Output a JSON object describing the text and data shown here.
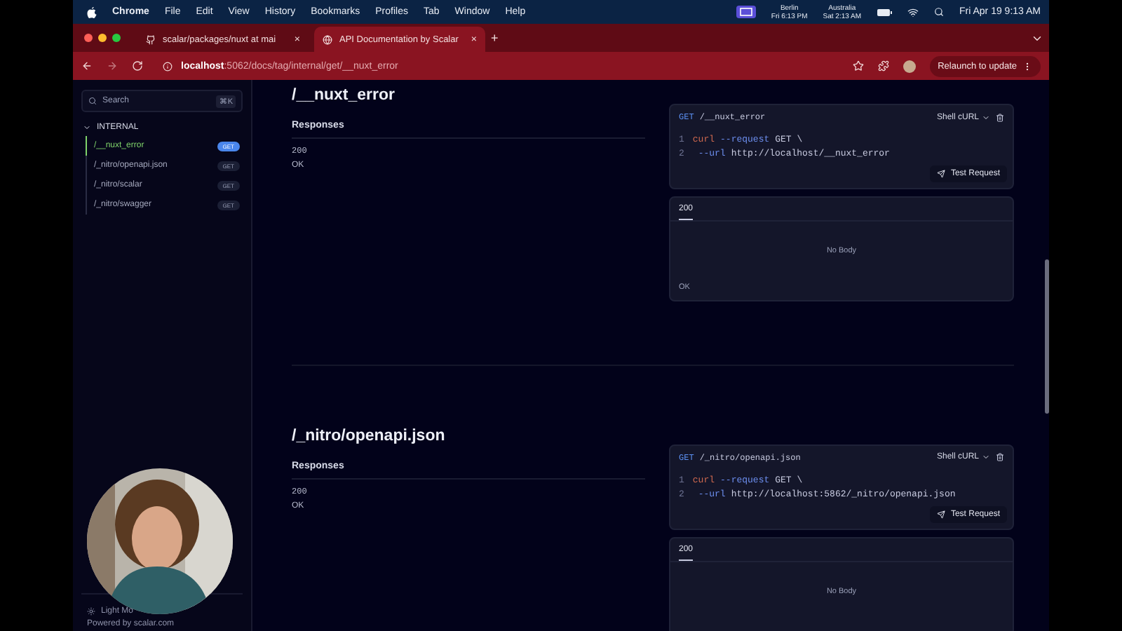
{
  "menubar": {
    "app": "Chrome",
    "menus": [
      "File",
      "Edit",
      "View",
      "History",
      "Bookmarks",
      "Profiles",
      "Tab",
      "Window",
      "Help"
    ],
    "clocks": [
      {
        "city": "Berlin",
        "time": "Fri 6:13 PM"
      },
      {
        "city": "Australia",
        "time": "Sat 2:13 AM"
      }
    ],
    "datetime": "Fri Apr 19  9:13 AM"
  },
  "tabs": [
    {
      "title": "scalar/packages/nuxt at mai",
      "selected": false,
      "close": "×"
    },
    {
      "title": "API Documentation by Scalar",
      "selected": true,
      "close": "×"
    }
  ],
  "new_tab": "+",
  "address_bar": {
    "host": "localhost",
    "path": ":5062/docs/tag/internal/get/__nuxt_error",
    "relaunch": "Relaunch to update"
  },
  "sidebar": {
    "search": {
      "placeholder": "Search",
      "shortcut": "⌘K"
    },
    "group": {
      "label": "INTERNAL",
      "expanded": true,
      "items": [
        {
          "label": "/__nuxt_error",
          "method": "GET",
          "selected": true
        },
        {
          "label": "/_nitro/openapi.json",
          "method": "GET",
          "selected": false
        },
        {
          "label": "/_nitro/scalar",
          "method": "GET",
          "selected": false
        },
        {
          "label": "/_nitro/swagger",
          "method": "GET",
          "selected": false
        }
      ]
    },
    "light_mode": "Light Mo",
    "powered_by": "Powered by scalar.com"
  },
  "operations": [
    {
      "title": "/__nuxt_error",
      "responses_label": "Responses",
      "status": "200",
      "description": "OK",
      "request": {
        "method": "GET",
        "path": "/__nuxt_error",
        "client": "Shell cURL",
        "test": "Test Request",
        "lines": [
          {
            "number": "1",
            "tokens": [
              {
                "kind": "command",
                "text": "curl"
              },
              {
                "kind": "flag",
                "text": "--request"
              },
              {
                "kind": "plain",
                "text": "GET \\"
              }
            ]
          },
          {
            "number": "2",
            "tokens": [
              {
                "kind": "flag",
                "text": "--url"
              },
              {
                "kind": "plain",
                "text": "http://localhost/__nuxt_error"
              }
            ]
          }
        ]
      },
      "response": {
        "tab": "200",
        "body": "No Body",
        "footer": "OK"
      }
    },
    {
      "title": "/_nitro/openapi.json",
      "responses_label": "Responses",
      "status": "200",
      "description": "OK",
      "request": {
        "method": "GET",
        "path": "/_nitro/openapi.json",
        "client": "Shell cURL",
        "test": "Test Request",
        "lines": [
          {
            "number": "1",
            "tokens": [
              {
                "kind": "command",
                "text": "curl"
              },
              {
                "kind": "flag",
                "text": "--request"
              },
              {
                "kind": "plain",
                "text": "GET \\"
              }
            ]
          },
          {
            "number": "2",
            "tokens": [
              {
                "kind": "flag",
                "text": "--url"
              },
              {
                "kind": "plain",
                "text": "http://localhost:5862/_nitro/openapi.json"
              }
            ]
          }
        ]
      },
      "response": {
        "tab": "200",
        "body": "No Body"
      }
    }
  ]
}
